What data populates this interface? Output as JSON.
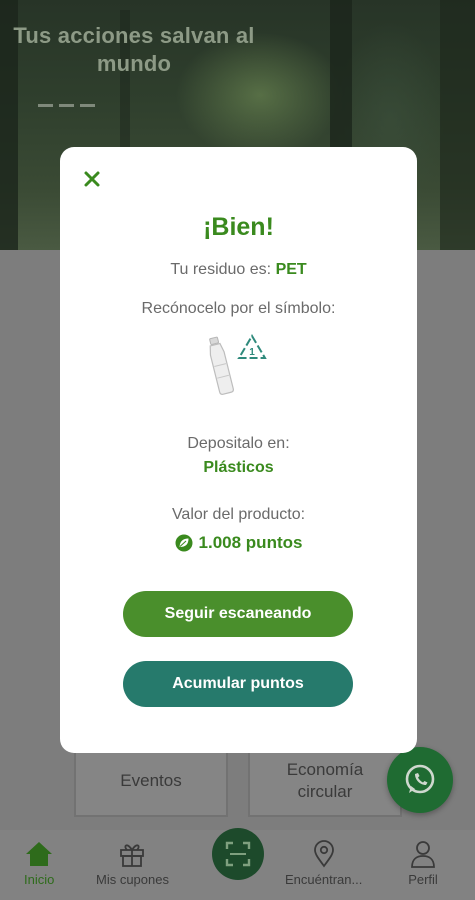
{
  "hero": {
    "title": "Tus acciones salvan al mundo"
  },
  "cards": {
    "events": "Eventos",
    "economy": "Economía circular"
  },
  "tabs": [
    {
      "label": "Inicio",
      "icon": "home-icon",
      "active": true
    },
    {
      "label": "Mis cupones",
      "icon": "gift-icon"
    },
    {
      "label": "scan",
      "icon": "scan-icon"
    },
    {
      "label": "Encuéntran...",
      "icon": "location-pin-icon"
    },
    {
      "label": "Perfil",
      "icon": "user-icon"
    }
  ],
  "modal": {
    "title": "¡Bien!",
    "residue_prefix": "Tu residuo es:",
    "residue_value": "PET",
    "symbol_text": "Recónocelo por el símbolo:",
    "recycle_number": "1",
    "deposit_prefix": "Depositalo en:",
    "deposit_value": "Plásticos",
    "value_prefix": "Valor del producto:",
    "points": "1.008 puntos",
    "btn_continue": "Seguir escaneando",
    "btn_accumulate": "Acumular puntos"
  },
  "colors": {
    "green": "#3a8a1e",
    "teal": "#267a6c",
    "button_green": "#4a8f2c"
  }
}
